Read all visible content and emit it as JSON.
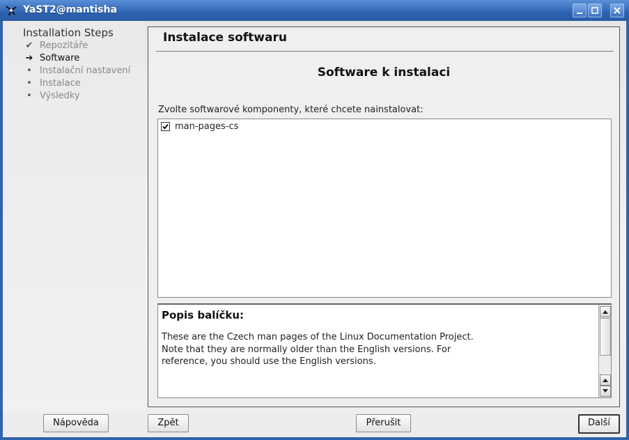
{
  "window": {
    "title": "YaST2@mantisha",
    "controls": [
      "minimize-icon",
      "maximize-icon",
      "close-icon"
    ]
  },
  "sidebar": {
    "title": "Installation Steps",
    "steps": [
      {
        "label": "Repozitáře",
        "status": "done",
        "mark": "✔"
      },
      {
        "label": "Software",
        "status": "current",
        "mark": "➔"
      },
      {
        "label": "Instalační nastavení",
        "status": "pending",
        "mark": "•"
      },
      {
        "label": "Instalace",
        "status": "pending",
        "mark": "•"
      },
      {
        "label": "Výsledky",
        "status": "pending",
        "mark": "•"
      }
    ]
  },
  "main": {
    "header": "Instalace softwaru",
    "heading": "Software k instalaci",
    "list_label": "Zvolte softwarové komponenty, které chcete nainstalovat:",
    "items": [
      {
        "label": "man-pages-cs",
        "checked": true
      }
    ],
    "description": {
      "title": "Popis balíčku:",
      "lines": [
        "These are the Czech man pages of the Linux Documentation Project.",
        "Note that they are normally older than the English versions. For",
        "reference, you should use the English versions."
      ]
    }
  },
  "buttons": {
    "help": "Nápověda",
    "back": "Zpět",
    "abort": "Přerušit",
    "next": "Další"
  },
  "colors": {
    "titlebar": "#2d62b0",
    "window_border": "#2f63ad",
    "panel_bg": "#efefef"
  }
}
